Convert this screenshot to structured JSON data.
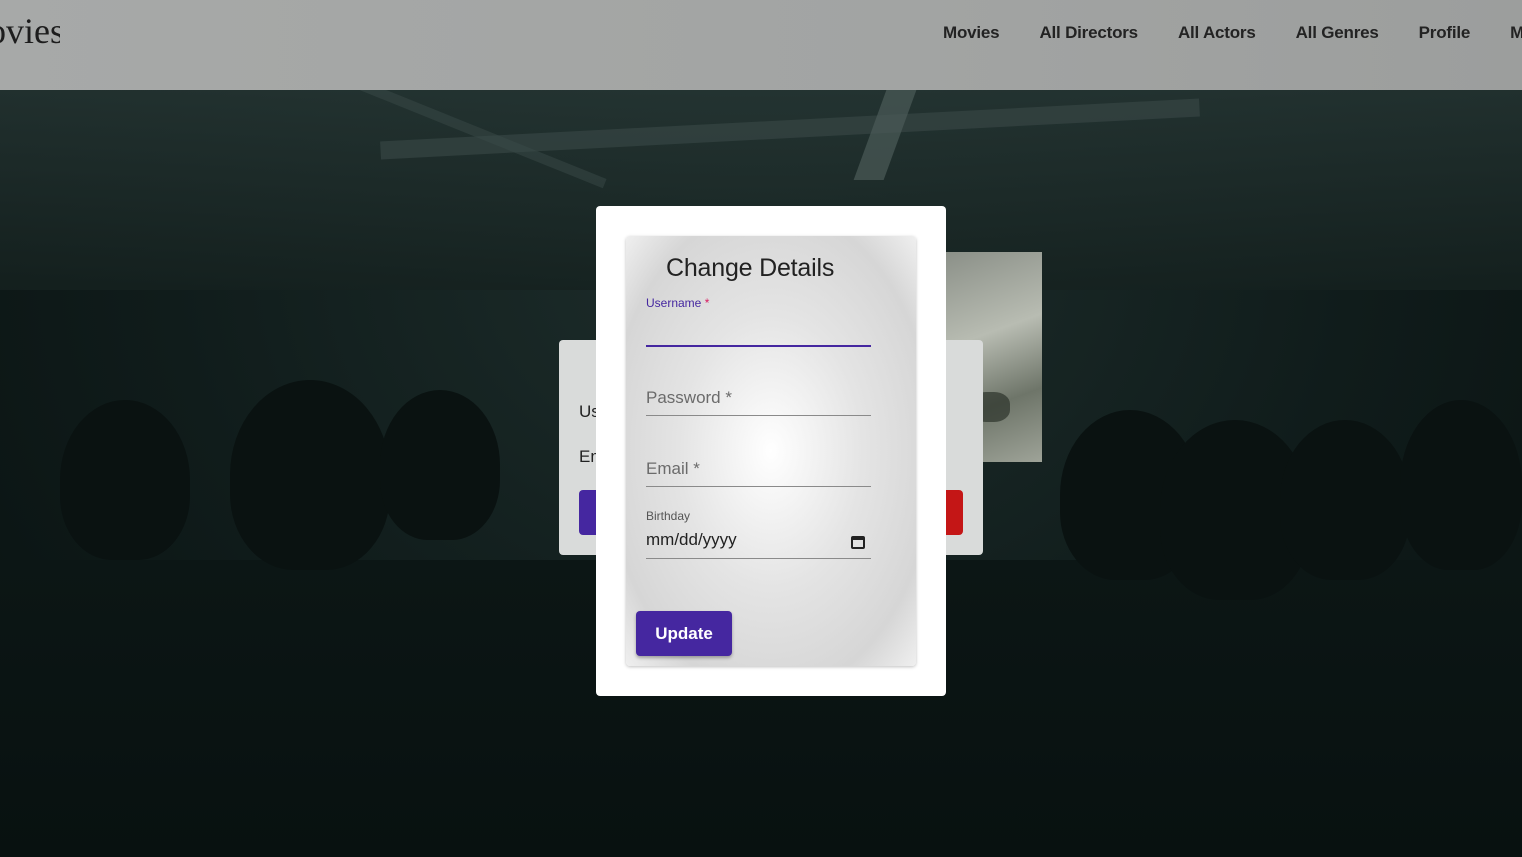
{
  "navbar": {
    "brand": "Movies",
    "items": [
      {
        "label": "Movies"
      },
      {
        "label": "All Directors"
      },
      {
        "label": "All Actors"
      },
      {
        "label": "All Genres"
      },
      {
        "label": "Profile"
      },
      {
        "label": "My"
      }
    ]
  },
  "profile_card": {
    "label_username": "Us",
    "label_email": "Em"
  },
  "modal": {
    "title": "Change Details",
    "fields": {
      "username": {
        "label": "Username",
        "required_mark": "*",
        "value": ""
      },
      "password": {
        "placeholder": "Password *",
        "value": ""
      },
      "email": {
        "placeholder": "Email *",
        "value": ""
      },
      "birthday": {
        "label": "Birthday",
        "value": "mm/dd/yyyy"
      }
    },
    "update_label": "Update"
  },
  "colors": {
    "accent": "#4527a0",
    "danger": "#c41616",
    "required": "#d81b60"
  }
}
